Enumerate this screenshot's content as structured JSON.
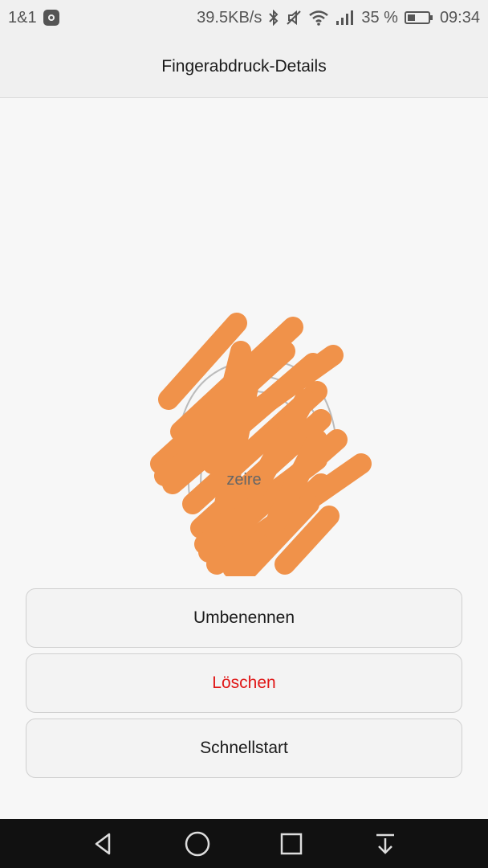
{
  "status_bar": {
    "carrier": "1&1",
    "speed": "39.5KB/s",
    "battery_percent": "35 %",
    "time": "09:34",
    "icons": [
      "notification-icon",
      "bluetooth-icon",
      "mute-icon",
      "wifi-icon",
      "signal-icon",
      "battery-icon"
    ]
  },
  "header": {
    "title": "Fingerabdruck-Details"
  },
  "fingerprint": {
    "name": "zeire",
    "overlay_color": "#f0924a"
  },
  "actions": {
    "rename_label": "Umbenennen",
    "delete_label": "Löschen",
    "quickstart_label": "Schnellstart",
    "delete_color": "#e01818"
  },
  "nav_bar": {
    "icons": [
      "back-icon",
      "home-icon",
      "recents-icon",
      "notification-pulldown-icon"
    ]
  }
}
